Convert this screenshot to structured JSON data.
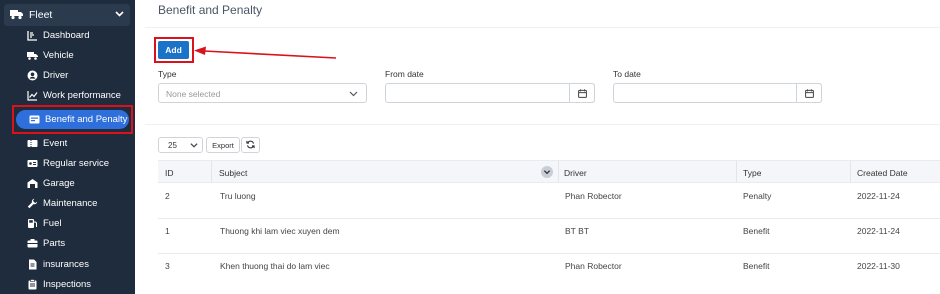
{
  "sidebar": {
    "section_label": "Fleet",
    "items": [
      {
        "label": "Dashboard",
        "icon": "chart-icon"
      },
      {
        "label": "Vehicle",
        "icon": "truck-icon"
      },
      {
        "label": "Driver",
        "icon": "user-icon"
      },
      {
        "label": "Work performance",
        "icon": "line-chart-icon"
      },
      {
        "label": "Benefit and Penalty",
        "icon": "wallet-icon",
        "active": true
      },
      {
        "label": "Event",
        "icon": "ticket-icon"
      },
      {
        "label": "Regular service",
        "icon": "service-icon"
      },
      {
        "label": "Garage",
        "icon": "garage-icon"
      },
      {
        "label": "Maintenance",
        "icon": "wrench-icon"
      },
      {
        "label": "Fuel",
        "icon": "fuel-icon"
      },
      {
        "label": "Parts",
        "icon": "parts-icon"
      },
      {
        "label": "insurances",
        "icon": "document-icon"
      },
      {
        "label": "Inspections",
        "icon": "clipboard-icon"
      }
    ]
  },
  "page": {
    "title": "Benefit and Penalty",
    "add_label": "Add"
  },
  "filters": {
    "type_label": "Type",
    "type_placeholder": "None selected",
    "from_label": "From date",
    "to_label": "To date"
  },
  "toolbar": {
    "page_length": "25",
    "export_label": "Export"
  },
  "table": {
    "columns": [
      "ID",
      "Subject",
      "Driver",
      "Type",
      "Created Date"
    ],
    "rows": [
      [
        "2",
        "Tru luong",
        "Phan Robector",
        "Penalty",
        "2022-11-24"
      ],
      [
        "1",
        "Thuong khi lam viec xuyen dem",
        "BT BT",
        "Benefit",
        "2022-11-24"
      ],
      [
        "3",
        "Khen thuong thai do lam viec",
        "Phan Robector",
        "Benefit",
        "2022-11-30"
      ]
    ]
  },
  "colors": {
    "sidebar_bg": "#1f2c3e",
    "active_pill": "#2f6fdc",
    "add_button": "#1a73c9",
    "highlight": "#d9121b"
  }
}
